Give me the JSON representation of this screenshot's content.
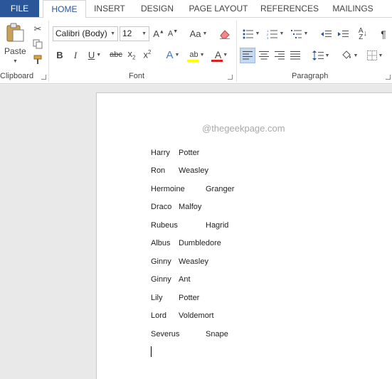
{
  "tabs": {
    "file": "FILE",
    "home": "HOME",
    "insert": "INSERT",
    "design": "DESIGN",
    "page_layout": "PAGE LAYOUT",
    "references": "REFERENCES",
    "mailings": "MAILINGS"
  },
  "clipboard": {
    "paste_label": "Paste",
    "group_label": "Clipboard"
  },
  "font": {
    "font_name": "Calibri (Body)",
    "font_size": "12",
    "group_label": "Font",
    "highlight_color": "#ffff00",
    "font_color": "#e02020"
  },
  "paragraph": {
    "group_label": "Paragraph"
  },
  "document": {
    "watermark": "@thegeekpage.com",
    "lines": [
      {
        "first": "Harry",
        "last": "Potter"
      },
      {
        "first": "Ron",
        "last": "Weasley"
      },
      {
        "first": "Hermoine",
        "last": "Granger"
      },
      {
        "first": "Draco",
        "last": "Malfoy"
      },
      {
        "first": "Rubeus",
        "last": "Hagrid"
      },
      {
        "first": "Albus",
        "last": "Dumbledore"
      },
      {
        "first": "Ginny",
        "last": "Weasley"
      },
      {
        "first": "Ginny",
        "last": "Ant"
      },
      {
        "first": "Lily",
        "last": "Potter"
      },
      {
        "first": "Lord",
        "last": "Voldemort"
      },
      {
        "first": "Severus",
        "last": "Snape"
      }
    ]
  },
  "colors": {
    "accent": "#2b579a",
    "ribbon_bg": "#ffffff",
    "doc_bg": "#e9e9e9"
  }
}
